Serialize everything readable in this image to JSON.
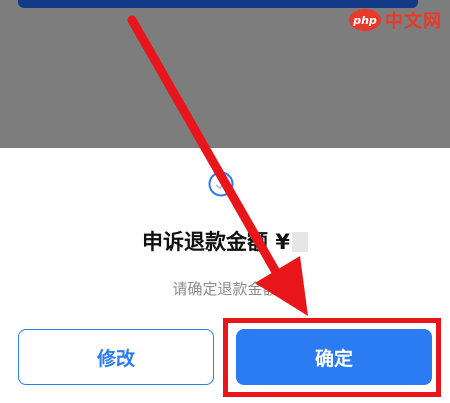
{
  "watermark": {
    "logo_text": "php",
    "site_text": "中文网",
    "color": "#e9392b"
  },
  "dialog": {
    "status_icon": "circle-status-icon",
    "title": "申诉退款金额 ¥",
    "subtitle": "请确定退款金额",
    "modify_label": "修改",
    "confirm_label": "确定"
  },
  "colors": {
    "primary": "#2b7bf3",
    "overlay": "#7d7d7d",
    "annotation_red": "#e8151a",
    "top_bar": "#123a86"
  }
}
